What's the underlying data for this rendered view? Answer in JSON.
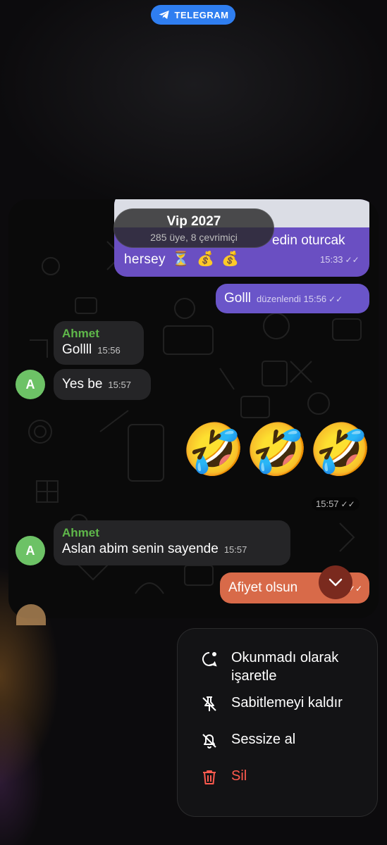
{
  "app_pill": {
    "label": "TELEGRAM"
  },
  "chat": {
    "title": "Vip 2027",
    "subtitle": "285 üye, 8 çevrimiçi",
    "messages": {
      "partial_line1": "edin oturcak",
      "partial_line2": "hersey",
      "partial_time": "15:33",
      "golll_text": "Golll",
      "golll_meta": "düzenlendi 15:56",
      "ahmet_name": "Ahmet",
      "ahmet_msg1": "Gollll",
      "ahmet_time1": "15:56",
      "yesbe_msg": "Yes be",
      "yesbe_time": "15:57",
      "sticker_emoji": "🤣",
      "sticker_time": "15:57",
      "ahmet_name2": "Ahmet",
      "aslan_msg": "Aslan abim senin sayende",
      "aslan_time": "15:57",
      "afiyet_msg": "Afiyet olsun",
      "avatar_letter": "A"
    }
  },
  "context_menu": {
    "items": [
      {
        "label": "Okunmadı olarak işaretle",
        "icon": "unread-bubble-icon"
      },
      {
        "label": "Sabitlemeyi kaldır",
        "icon": "unpin-icon"
      },
      {
        "label": "Sessize al",
        "icon": "bell-mute-icon"
      },
      {
        "label": "Sil",
        "icon": "trash-icon"
      }
    ]
  },
  "colors": {
    "outgoing_bubble": "#6a55c9",
    "incoming_bubble": "#252527",
    "sender_name": "#5fb84a",
    "danger": "#ff5a4e",
    "telegram_blue": "#2f7ef0"
  }
}
